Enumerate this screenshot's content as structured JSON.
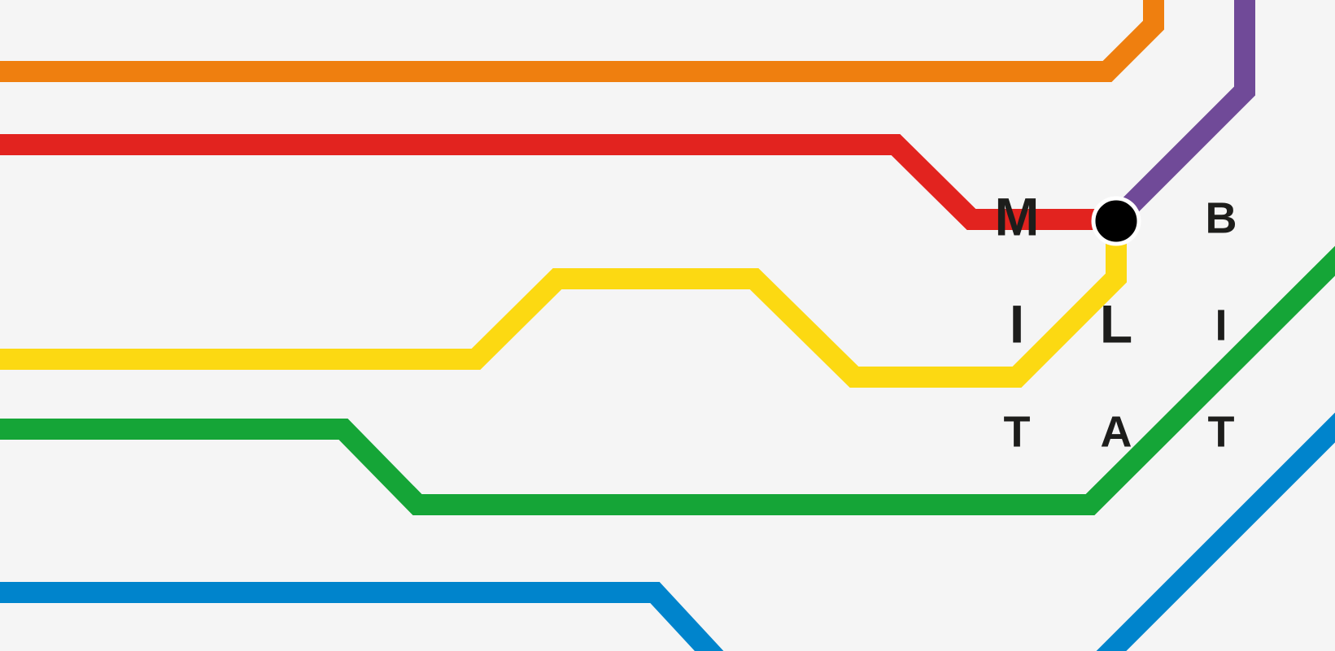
{
  "letters": {
    "l1": "M",
    "l2": "B",
    "l3": "I",
    "l4": "L",
    "l5": "I",
    "l6": "T",
    "l7": "A",
    "l8": "T"
  },
  "colors": {
    "background": "#f5f5f5",
    "orange": "#ef7f0f",
    "purple": "#704a98",
    "red": "#e2231f",
    "yellow": "#fcd912",
    "green": "#15a537",
    "blue": "#0084cc",
    "station": "#000000",
    "text": "#1d1d1b"
  }
}
